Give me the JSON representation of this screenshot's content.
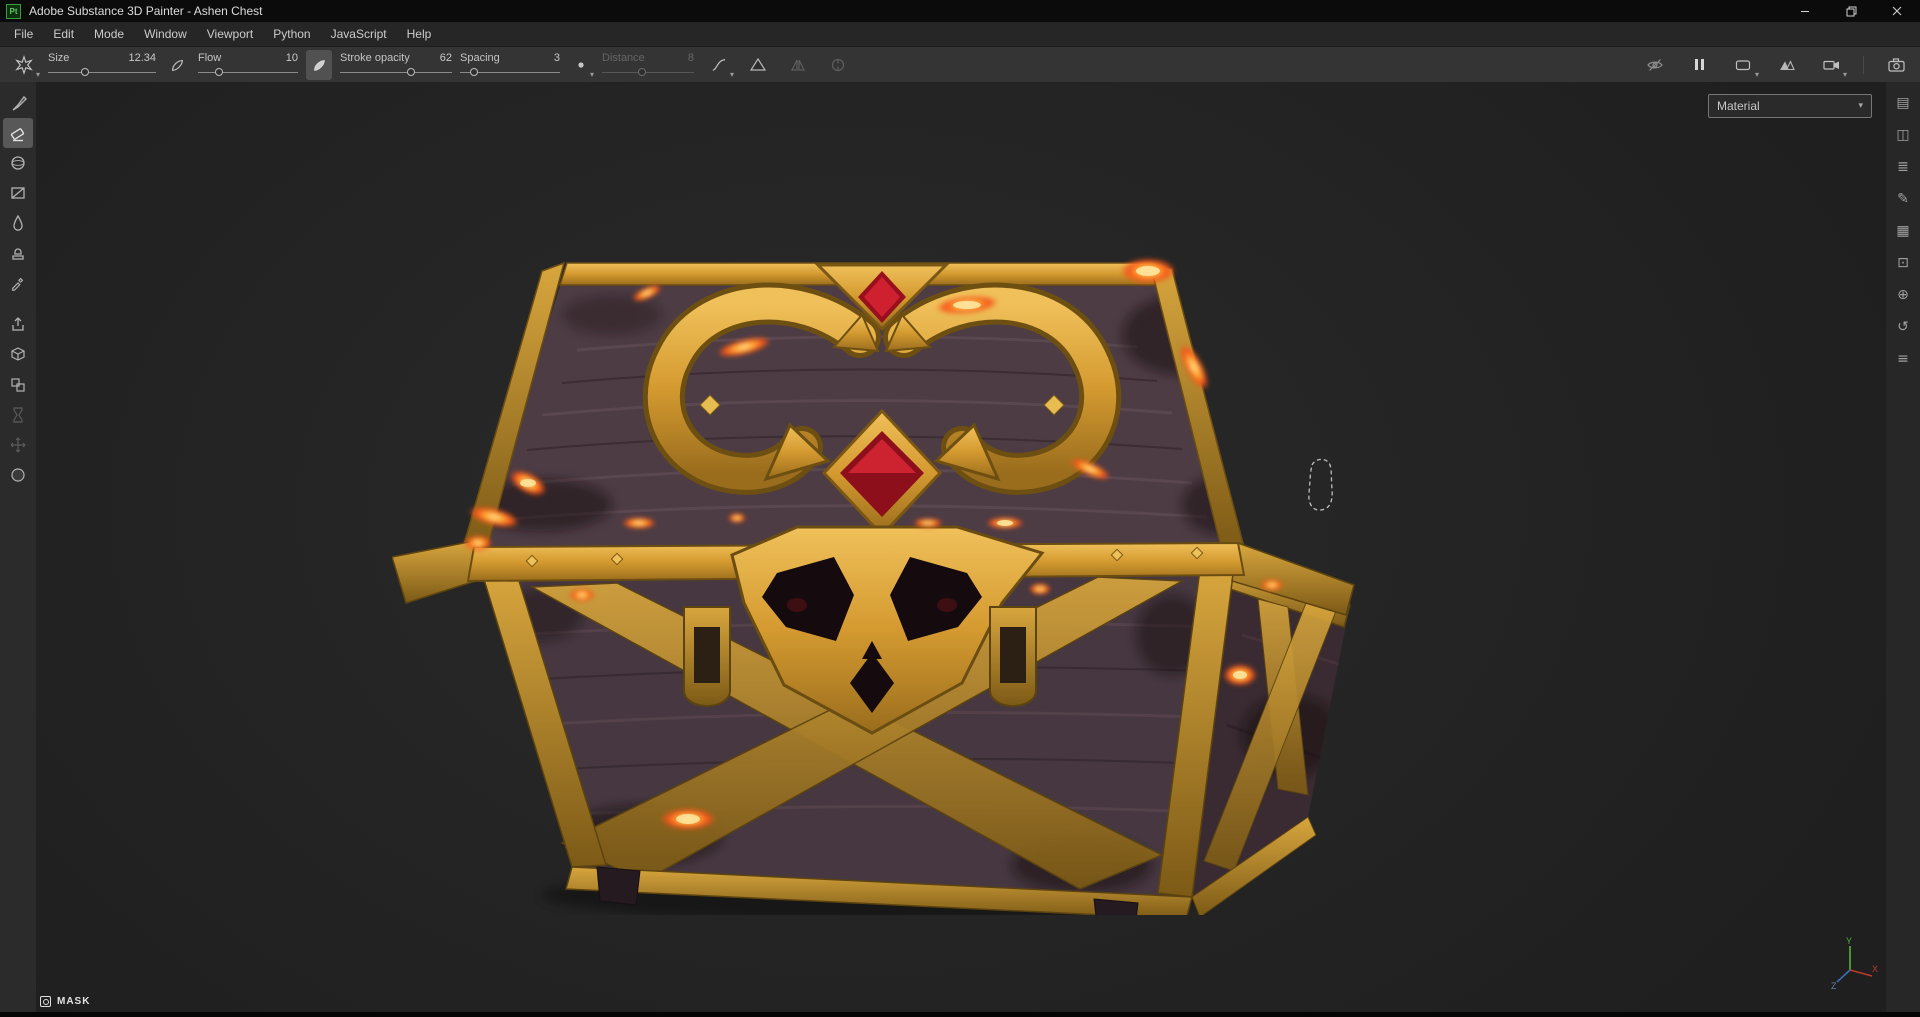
{
  "window": {
    "app_badge": "Pt",
    "title": "Adobe Substance 3D Painter - Ashen Chest"
  },
  "menubar": {
    "items": [
      "File",
      "Edit",
      "Mode",
      "Window",
      "Viewport",
      "Python",
      "JavaScript",
      "Help"
    ]
  },
  "toolbar": {
    "params": [
      {
        "label": "Size",
        "value": "12.34",
        "enabled": true,
        "knob_pct": 34
      },
      {
        "label": "Flow",
        "value": "10",
        "enabled": true,
        "knob_pct": 21
      },
      {
        "label": "Stroke opacity",
        "value": "62",
        "enabled": true,
        "knob_pct": 63
      },
      {
        "label": "Spacing",
        "value": "3",
        "enabled": true,
        "knob_pct": 14
      },
      {
        "label": "Distance",
        "value": "8",
        "enabled": false,
        "knob_pct": 44
      }
    ],
    "icon_names": [
      "brush-preset",
      "brush-tip",
      "brush-angle",
      "lazy-mouse",
      "falloff-curve",
      "symmetry-pyramid",
      "symmetry-mirror",
      "symmetry-radial",
      "visibility-off",
      "pause",
      "viewport-frame",
      "viewport-shading",
      "camera-view",
      "screenshot-camera"
    ]
  },
  "left_toolbar": {
    "tools": [
      {
        "name": "paint-brush",
        "selected": false
      },
      {
        "name": "eraser",
        "selected": true
      },
      {
        "name": "projection",
        "selected": false
      },
      {
        "name": "polygon-fill",
        "selected": false
      },
      {
        "name": "smudge",
        "selected": false
      },
      {
        "name": "clone-stamp",
        "selected": false
      },
      {
        "name": "material-picker",
        "selected": false
      },
      {
        "name": "export-resources",
        "selected": false
      },
      {
        "name": "geometry-mask",
        "selected": false
      },
      {
        "name": "instances",
        "selected": false
      },
      {
        "name": "bake",
        "selected": false,
        "enabled": false
      },
      {
        "name": "transform",
        "selected": false,
        "enabled": false
      },
      {
        "name": "sphere",
        "selected": false
      }
    ]
  },
  "viewport": {
    "material_dropdown": {
      "value": "Material"
    },
    "mask_indicator": {
      "label": "MASK"
    },
    "axis_gizmo": {
      "x": "X",
      "y": "Y",
      "z": "Z"
    },
    "scene": "ashen treasure chest 3d model with gold trim, red gems and glowing lava cracks"
  },
  "right_panel_strip": {
    "icons": [
      {
        "name": "texture-set-settings-panel",
        "glyph": "▤"
      },
      {
        "name": "split-view-panel",
        "glyph": "◫"
      },
      {
        "name": "layers-panel",
        "glyph": "≣"
      },
      {
        "name": "brush-settings-panel",
        "glyph": "✎"
      },
      {
        "name": "assets-panel",
        "glyph": "▦"
      },
      {
        "name": "display-settings-panel",
        "glyph": "⊡"
      },
      {
        "name": "shader-settings-panel",
        "glyph": "⊕"
      },
      {
        "name": "history-panel",
        "glyph": "↺"
      },
      {
        "name": "log-panel",
        "glyph": "≡"
      }
    ]
  },
  "colors": {
    "gold": "#d9a43c",
    "lava_orange": "#ff6a1e",
    "gem_red": "#a81220",
    "viewport_bg": "#242424",
    "toolbar_bg": "#343434",
    "titlebar_bg": "#0b0b0b"
  }
}
